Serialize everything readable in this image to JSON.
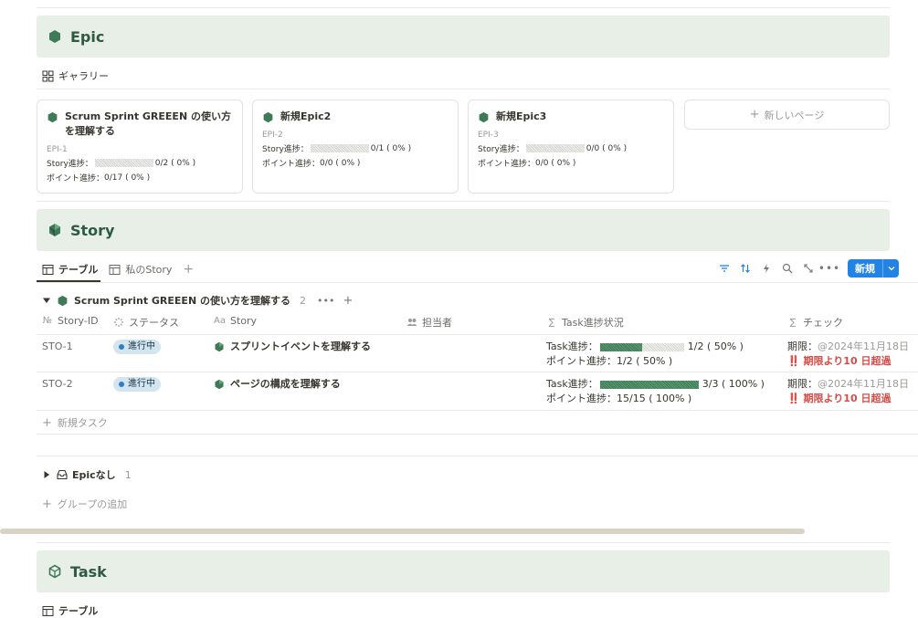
{
  "colors": {
    "band": "#e8efe6",
    "accent": "#2e5a43",
    "primary": "#2383e2",
    "overdue": "#d44c47",
    "status_bg": "#d3e5ef"
  },
  "epic": {
    "title": "Epic",
    "view_label": "ギャラリー",
    "cards": [
      {
        "title": "Scrum Sprint GREEEN の使い方を理解する",
        "id": "EPI-1",
        "story_label": "Story進捗：",
        "story_value": "0/2 ( 0% )",
        "story_pct": 0,
        "point_label": "ポイント進捗：",
        "point_value": "0/17 ( 0% )"
      },
      {
        "title": "新規Epic2",
        "id": "EPI-2",
        "story_label": "Story進捗：",
        "story_value": "0/1 ( 0% )",
        "story_pct": 0,
        "point_label": "ポイント進捗：",
        "point_value": "0/0 ( 0% )"
      },
      {
        "title": "新規Epic3",
        "id": "EPI-3",
        "story_label": "Story進捗：",
        "story_value": "0/0 ( 0% )",
        "story_pct": 0,
        "point_label": "ポイント進捗：",
        "point_value": "0/0 ( 0% )"
      }
    ],
    "new_page": "新しいページ"
  },
  "story": {
    "title": "Story",
    "tabs": [
      {
        "label": "テーブル"
      },
      {
        "label": "私のStory"
      }
    ],
    "new_button": "新規",
    "group": {
      "name": "Scrum Sprint GREEEN の使い方を理解する",
      "count": "2"
    },
    "columns": {
      "id": "Story-ID",
      "status": "ステータス",
      "story": "Story",
      "assignee": "担当者",
      "task": "Task進捗状況",
      "check": "チェック"
    },
    "rows": [
      {
        "id": "STO-1",
        "status": "進行中",
        "name": "スプリントイベントを理解する",
        "task_label": "Task進捗：",
        "task_value": "1/2 ( 50% )",
        "task_pct": 50,
        "point_text": "ポイント進捗：1/2 ( 50% )",
        "deadline_label": "期限：",
        "deadline_date": "@2024年11月18日",
        "overdue": "‼️ 期限より10 日超過"
      },
      {
        "id": "STO-2",
        "status": "進行中",
        "name": "ページの構成を理解する",
        "task_label": "Task進捗：",
        "task_value": "3/3 ( 100% )",
        "task_pct": 100,
        "point_text": "ポイント進捗：15/15 ( 100% )",
        "deadline_label": "期限：",
        "deadline_date": "@2024年11月18日",
        "overdue": "‼️ 期限より10 日超過"
      }
    ],
    "new_task": "新規タスク",
    "group2": {
      "name": "Epicなし",
      "count": "1"
    },
    "add_group": "グループの追加"
  },
  "task": {
    "title": "Task",
    "view_label": "テーブル"
  }
}
